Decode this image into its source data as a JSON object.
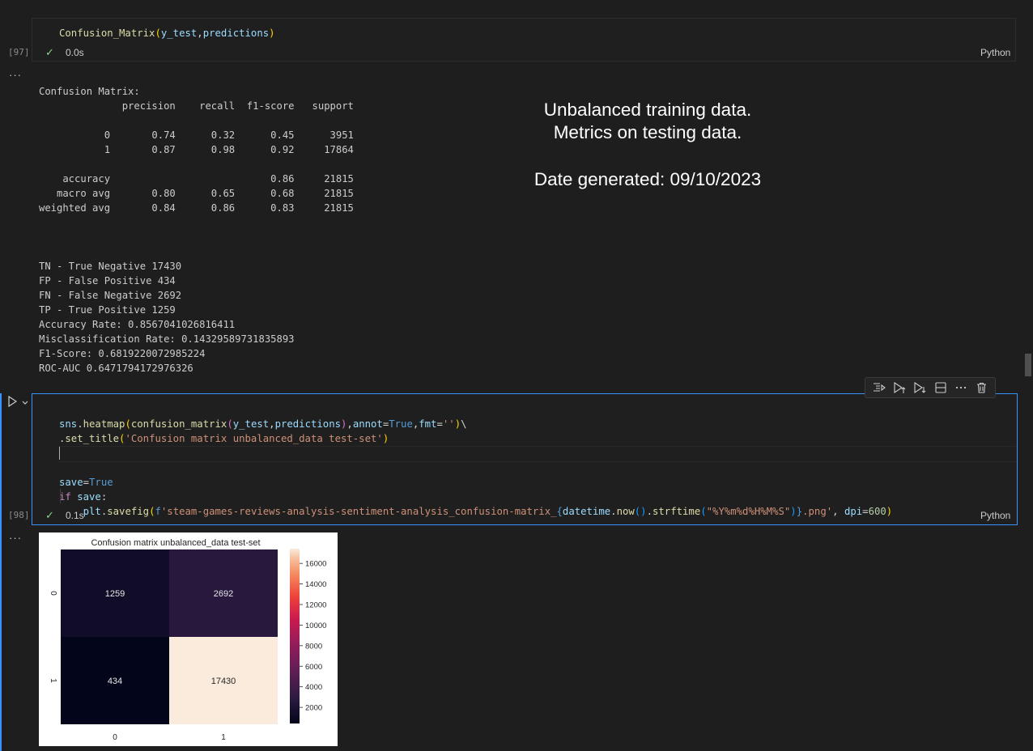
{
  "cell97": {
    "exec_count": "[97]",
    "status_time": "0.0s",
    "language": "Python"
  },
  "output97": {
    "ellipsis": "···",
    "report_lines": [
      "Confusion Matrix:",
      "              precision    recall  f1-score   support",
      "",
      "           0       0.74      0.32      0.45      3951",
      "           1       0.87      0.98      0.92     17864",
      "",
      "    accuracy                           0.86     21815",
      "   macro avg       0.80      0.65      0.68     21815",
      "weighted avg       0.84      0.86      0.83     21815"
    ],
    "metric_lines": [
      "TN - True Negative 17430",
      "FP - False Positive 434",
      "FN - False Negative 2692",
      "TP - True Positive 1259",
      "Accuracy Rate: 0.8567041026816411",
      "Misclassification Rate: 0.14329589731835893",
      "F1-Score: 0.6819220072985224",
      "ROC-AUC 0.6471794172976326"
    ],
    "overlay": {
      "line1": "Unbalanced training data.",
      "line2": "Metrics on testing data.",
      "line3": "Date generated: 09/10/2023"
    }
  },
  "cell98": {
    "exec_count": "[98]",
    "status_time": "0.1s",
    "language": "Python"
  },
  "output98": {
    "ellipsis": "···"
  },
  "chart_data": {
    "type": "heatmap",
    "title": "Confusion matrix unbalanced_data test-set",
    "x_ticks": [
      "0",
      "1"
    ],
    "y_ticks": [
      "0",
      "1"
    ],
    "values": [
      [
        1259,
        2692
      ],
      [
        434,
        17430
      ]
    ],
    "colorbar_ticks": [
      2000,
      4000,
      6000,
      8000,
      10000,
      12000,
      14000,
      16000
    ],
    "colorbar_range": [
      434,
      17430
    ],
    "colormap": "rocket"
  }
}
